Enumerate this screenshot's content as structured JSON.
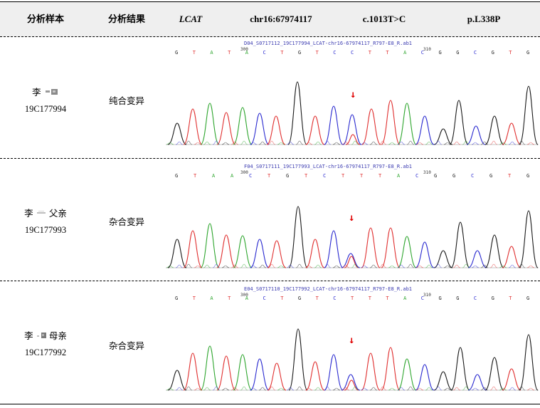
{
  "header": {
    "sample_col": "分析样本",
    "result_col": "分析结果",
    "gene": "LCAT",
    "position": "chr16:67974117",
    "cdna": "c.1013T>C",
    "protein": "p.L338P"
  },
  "rows": [
    {
      "name_prefix": "李",
      "name_suffix": "",
      "sample_id": "19C177994",
      "result": "纯合变异",
      "trace": {
        "file_label": "D04_S0717112_19C177994_LCAT-chr16-67974117_R797-E8_R.ab1",
        "bases": [
          "G",
          "T",
          "A",
          "T",
          "A",
          "C",
          "T",
          "G",
          "T",
          "C",
          "C",
          "T",
          "T",
          "A",
          "C",
          "G",
          "G",
          "C",
          "G",
          "T",
          "G"
        ],
        "pos_labels": [
          "300",
          "310"
        ],
        "arrow": "↓"
      }
    },
    {
      "name_prefix": "李",
      "name_suffix": "父亲",
      "sample_id": "19C177993",
      "result": "杂合变异",
      "trace": {
        "file_label": "F04_S0717111_19C177993_LCAT-chr16-67974117_R797-E8_R.ab1",
        "bases": [
          "G",
          "T",
          "A",
          "A",
          "C",
          "T",
          "G",
          "T",
          "C",
          "T",
          "T",
          "T",
          "A",
          "C",
          "G",
          "G",
          "C",
          "G",
          "T",
          "G"
        ],
        "pos_labels": [
          "300",
          "310"
        ],
        "arrow": "↓"
      }
    },
    {
      "name_prefix": "李",
      "name_suffix": "母亲",
      "sample_id": "19C177992",
      "result": "杂合变异",
      "trace": {
        "file_label": "E04_S0717110_19C177992_LCAT-chr16-67974117_R797-E8_R.ab1",
        "bases": [
          "G",
          "T",
          "A",
          "T",
          "A",
          "C",
          "T",
          "G",
          "T",
          "C",
          "T",
          "T",
          "T",
          "A",
          "C",
          "G",
          "G",
          "C",
          "G",
          "T",
          "G"
        ],
        "pos_labels": [
          "300",
          "310"
        ],
        "arrow": "↓"
      }
    }
  ],
  "colors": {
    "A": "#2fa62f",
    "C": "#2b2bd0",
    "G": "#1a1a1a",
    "T": "#e03030",
    "arrow": "#e00000",
    "label": "#3a3ab0",
    "header_bg": "#efefef"
  }
}
